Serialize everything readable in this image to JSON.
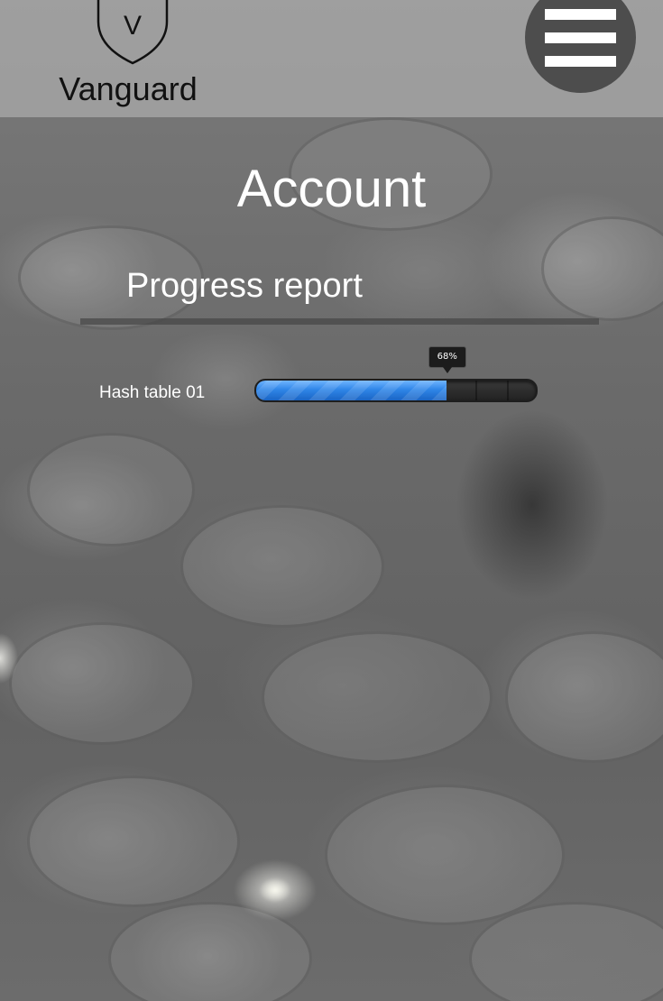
{
  "header": {
    "brand_name": "Vanguard",
    "logo_letter": "V",
    "menu_icon": "hamburger-menu-icon"
  },
  "main": {
    "title": "Account",
    "section_title": "Progress report",
    "progress_items": [
      {
        "label": "Hash table 01",
        "percent": 68,
        "percent_label": "68%"
      }
    ]
  },
  "colors": {
    "progress_fill": "#2f86e8",
    "header_text": "#111111",
    "menu_button": "#4d4d4d"
  }
}
